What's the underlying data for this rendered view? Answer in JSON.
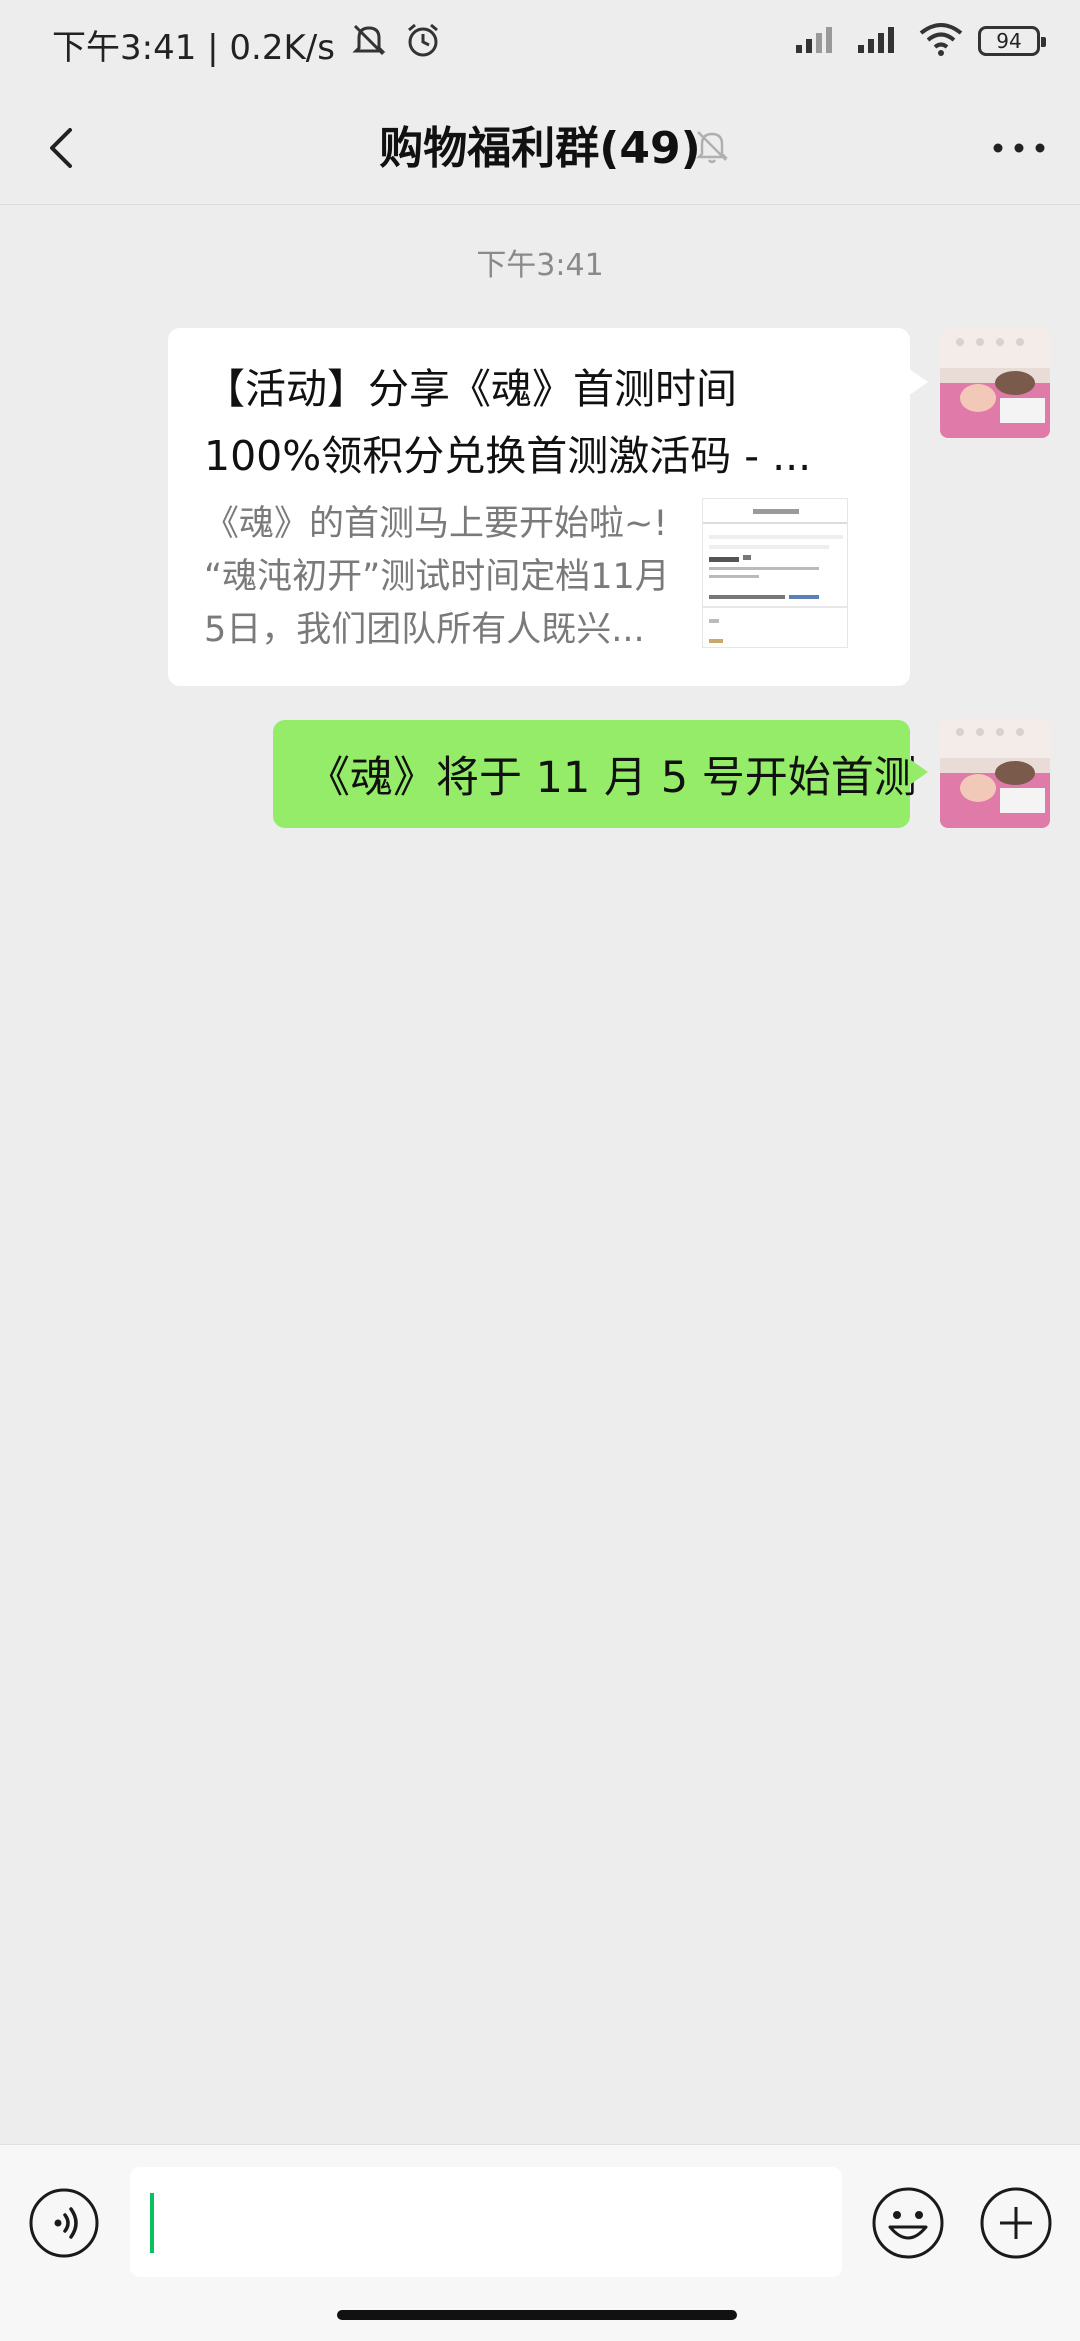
{
  "status_bar": {
    "time_speed": "下午3:41 | 0.2K/s",
    "battery": "94",
    "icons": [
      "mute-notification-icon",
      "alarm-icon",
      "signal-icon",
      "signal-icon",
      "wifi-icon",
      "battery-icon"
    ]
  },
  "nav": {
    "title": "购物福利群(49)",
    "back_icon": "back-icon",
    "mute_icon": "muted-bell-icon",
    "more_icon": "more-icon"
  },
  "chat": {
    "timestamp": "下午3:41",
    "messages": [
      {
        "type": "link_card",
        "title_line1": "【活动】分享《魂》首测时间",
        "title_line2": "100%领积分兑换首测激活码 - ...",
        "desc_line1": "《魂》的首测马上要开始啦~!",
        "desc_line2": "“魂沌初开”测试时间定档11月",
        "desc_line3": "5日，我们团队所有人既兴...",
        "thumbnail": "article-thumbnail"
      },
      {
        "type": "text",
        "text": "《魂》将于 11 月 5 号开始首测"
      }
    ]
  },
  "input_bar": {
    "voice_icon": "voice-icon",
    "emoji_icon": "emoji-icon",
    "plus_icon": "plus-icon"
  },
  "colors": {
    "background": "#ededed",
    "sent_bubble": "#95ec69",
    "caret": "#07c160"
  }
}
